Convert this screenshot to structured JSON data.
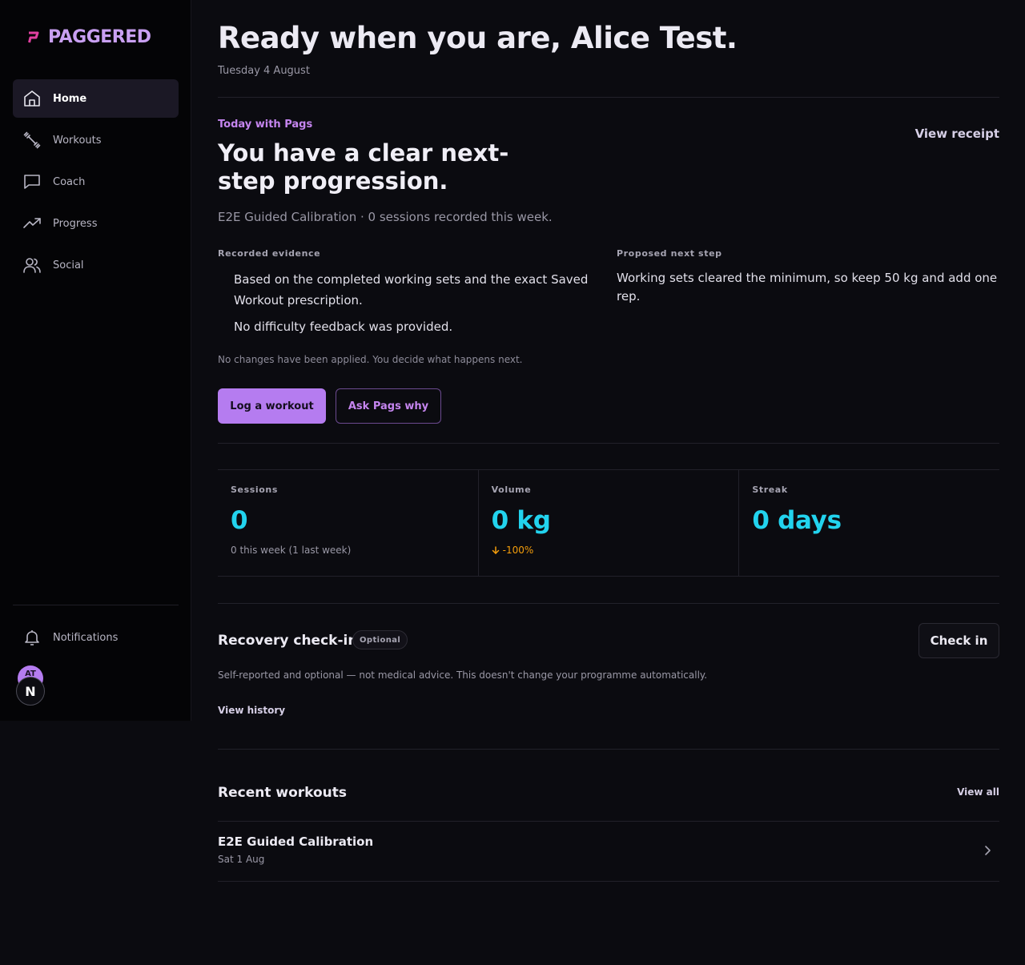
{
  "app": {
    "name": "PAGGERED",
    "brand_color": "#b57cf0",
    "accent_color": "#22d3ee"
  },
  "sidebar": {
    "items": [
      {
        "label": "Home",
        "icon": "home-icon",
        "active": true
      },
      {
        "label": "Workouts",
        "icon": "dumbbell-icon",
        "active": false
      },
      {
        "label": "Coach",
        "icon": "chat-icon",
        "active": false
      },
      {
        "label": "Progress",
        "icon": "trending-up-icon",
        "active": false
      },
      {
        "label": "Social",
        "icon": "users-icon",
        "active": false
      }
    ],
    "notifications_label": "Notifications",
    "avatar_initials": "AT",
    "badge_letter": "N"
  },
  "header": {
    "title": "Ready when you are, Alice Test.",
    "date": "Tuesday 4 August"
  },
  "today": {
    "eyebrow": "Today with Pags",
    "receipt_link": "View receipt",
    "headline": "You have a clear next-step progression.",
    "subtitle": "E2E Guided Calibration · 0 sessions recorded this week.",
    "evidence_label": "Recorded evidence",
    "evidence": [
      "Based on the completed working sets and the exact Saved Workout prescription.",
      "No difficulty feedback was provided."
    ],
    "proposal_label": "Proposed next step",
    "proposal": "Working sets cleared the minimum, so keep 50 kg and add one rep.",
    "note": "No changes have been applied. You decide what happens next.",
    "primary_button": "Log a workout",
    "secondary_button": "Ask Pags why"
  },
  "stats": [
    {
      "label": "Sessions",
      "value": "0",
      "sub": "0 this week (1 last week)"
    },
    {
      "label": "Volume",
      "value": "0 kg",
      "delta": "-100%"
    },
    {
      "label": "Streak",
      "value": "0 days"
    }
  ],
  "recovery": {
    "title": "Recovery check-in",
    "badge": "Optional",
    "button": "Check in",
    "description": "Self-reported and optional — not medical advice. This doesn't change your programme automatically.",
    "history_link": "View history"
  },
  "recent": {
    "title": "Recent workouts",
    "view_all": "View all",
    "items": [
      {
        "name": "E2E Guided Calibration",
        "date": "Sat 1 Aug"
      }
    ]
  }
}
